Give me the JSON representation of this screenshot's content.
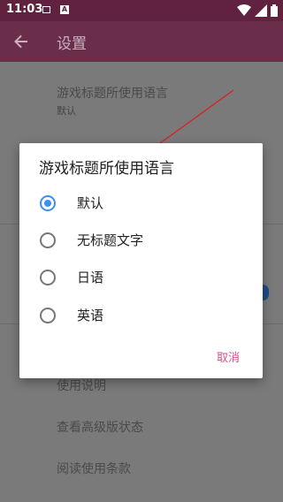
{
  "status_bar": {
    "time": "11:03",
    "notif_badge": "A"
  },
  "app_bar": {
    "title": "设置",
    "back_icon": "arrow-left-icon"
  },
  "settings": [
    {
      "title": "游戏标题所使用语言",
      "subtitle": "默认"
    },
    {
      "title": "使用说明"
    },
    {
      "title": "查看高级版状态"
    },
    {
      "title": "阅读使用条款"
    }
  ],
  "dialog": {
    "title": "游戏标题所使用语言",
    "options": [
      {
        "label": "默认",
        "selected": true
      },
      {
        "label": "无标题文字",
        "selected": false
      },
      {
        "label": "日语",
        "selected": false
      },
      {
        "label": "英语",
        "selected": false
      }
    ],
    "cancel_label": "取消"
  },
  "colors": {
    "accent": "#3d8ff2",
    "cancel": "#d94f8c",
    "status_bar": "#60223f",
    "app_bar": "#6a2e4a"
  }
}
